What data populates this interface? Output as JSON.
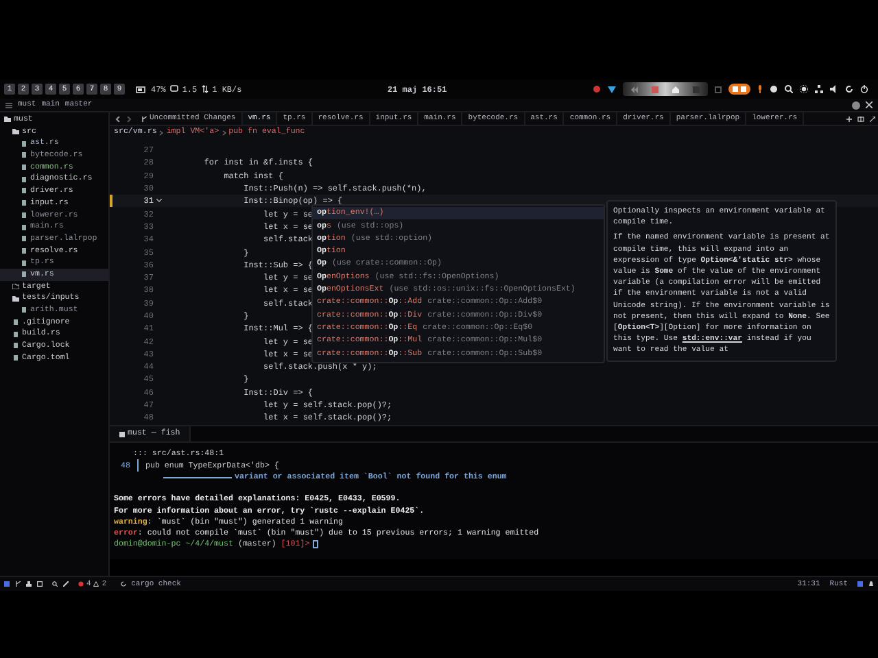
{
  "system_bar": {
    "workspaces": [
      "1",
      "2",
      "3",
      "4",
      "5",
      "6",
      "7",
      "8",
      "9"
    ],
    "battery": "47%",
    "load": "1.5",
    "network": "1 KB/s",
    "clock": "21 maj 16:51"
  },
  "title_bar": {
    "project": "must",
    "worktree": "main",
    "branch": "master"
  },
  "sidebar": {
    "items": [
      {
        "label": "must",
        "kind": "folder",
        "expanded": true,
        "selected": false,
        "children": [
          {
            "label": "src",
            "kind": "folder",
            "expanded": true,
            "selected": false,
            "children": [
              {
                "label": "ast.rs",
                "kind": "file",
                "selected": false,
                "color": "#a9b4c4"
              },
              {
                "label": "bytecode.rs",
                "kind": "file",
                "selected": false,
                "color": "#8a8f99"
              },
              {
                "label": "common.rs",
                "kind": "file",
                "selected": false,
                "color": "#8fb98b"
              },
              {
                "label": "diagnostic.rs",
                "kind": "file",
                "selected": false
              },
              {
                "label": "driver.rs",
                "kind": "file",
                "selected": false
              },
              {
                "label": "input.rs",
                "kind": "file",
                "selected": false
              },
              {
                "label": "lowerer.rs",
                "kind": "file",
                "selected": false,
                "color": "#8a8f99"
              },
              {
                "label": "main.rs",
                "kind": "file",
                "selected": false,
                "color": "#8a8f99"
              },
              {
                "label": "parser.lalrpop",
                "kind": "file",
                "selected": false,
                "color": "#8a8f99"
              },
              {
                "label": "resolve.rs",
                "kind": "file",
                "selected": false
              },
              {
                "label": "tp.rs",
                "kind": "file",
                "selected": false,
                "color": "#8a8f99"
              },
              {
                "label": "vm.rs",
                "kind": "file",
                "selected": true
              }
            ]
          },
          {
            "label": "target",
            "kind": "folder",
            "expanded": false,
            "selected": false
          },
          {
            "label": "tests/inputs",
            "kind": "folder",
            "expanded": true,
            "selected": false,
            "children": [
              {
                "label": "arith.must",
                "kind": "file",
                "selected": false,
                "color": "#8a8f99"
              }
            ]
          },
          {
            "label": ".gitignore",
            "kind": "file",
            "selected": false
          },
          {
            "label": "build.rs",
            "kind": "file",
            "selected": false
          },
          {
            "label": "Cargo.lock",
            "kind": "file",
            "selected": false
          },
          {
            "label": "Cargo.toml",
            "kind": "file",
            "selected": false
          }
        ]
      }
    ]
  },
  "tabs": [
    {
      "label": "Uncommitted Changes",
      "kind": "diff",
      "selected": false
    },
    {
      "label": "vm.rs",
      "kind": "file",
      "selected": true
    },
    {
      "label": "tp.rs",
      "kind": "file",
      "selected": false
    },
    {
      "label": "resolve.rs",
      "kind": "file",
      "selected": false
    },
    {
      "label": "input.rs",
      "kind": "file",
      "selected": false
    },
    {
      "label": "main.rs",
      "kind": "file",
      "selected": false
    },
    {
      "label": "bytecode.rs",
      "kind": "file",
      "selected": false
    },
    {
      "label": "ast.rs",
      "kind": "file",
      "selected": false
    },
    {
      "label": "common.rs",
      "kind": "file",
      "selected": false
    },
    {
      "label": "driver.rs",
      "kind": "file",
      "selected": false
    },
    {
      "label": "parser.lalrpop",
      "kind": "file",
      "selected": false
    },
    {
      "label": "lowerer.rs",
      "kind": "file",
      "selected": false
    }
  ],
  "breadcrumb": [
    "src/vm.rs",
    "impl VM<'a>",
    "pub fn eval_func"
  ],
  "editor": {
    "lines": [
      {
        "number": "27",
        "current": false
      },
      {
        "number": "28",
        "code": "        for inst in &f.insts {",
        "current": false
      },
      {
        "number": "29",
        "code": "            match inst {",
        "current": false
      },
      {
        "number": "30",
        "code": "                Inst::Push(n) => self.stack.push(*n),",
        "current": false
      },
      {
        "number": "31",
        "code": "                Inst::Binop(op) => {",
        "current": true
      },
      {
        "number": "32",
        "code": "                    let y = se",
        "current": false
      },
      {
        "number": "33",
        "code": "                    let x = se",
        "current": false
      },
      {
        "number": "34",
        "code": "                    self.stack",
        "current": false
      },
      {
        "number": "35",
        "code": "                }",
        "current": false
      },
      {
        "number": "36",
        "code": "                Inst::Sub => {",
        "current": false
      },
      {
        "number": "37",
        "code": "                    let y = se",
        "current": false
      },
      {
        "number": "38",
        "code": "                    let x = se",
        "current": false
      },
      {
        "number": "39",
        "code": "                    self.stack",
        "current": false
      },
      {
        "number": "40",
        "code": "                }",
        "current": false
      },
      {
        "number": "41",
        "code": "                Inst::Mul => {",
        "current": false
      },
      {
        "number": "42",
        "code": "                    let y = se",
        "current": false
      },
      {
        "number": "43",
        "code": "                    let x = se",
        "current": false
      },
      {
        "number": "44",
        "code": "                    self.stack.push(x * y);",
        "current": false
      },
      {
        "number": "45",
        "code": "                }",
        "current": false
      },
      {
        "number": "46",
        "code": "                Inst::Div => {",
        "current": false
      },
      {
        "number": "47",
        "code": "                    let y = self.stack.pop()?;",
        "current": false
      },
      {
        "number": "48",
        "code": "                    let x = self.stack.pop()?;",
        "current": false
      }
    ]
  },
  "completion": {
    "items": [
      {
        "label": "**op**tion_env!(…)",
        "selected": true
      },
      {
        "label": "**op**s",
        "detail": "(use std::ops)",
        "selected": false
      },
      {
        "label": "**op**tion",
        "detail": "(use std::option)",
        "selected": false
      },
      {
        "label": "**Op**tion",
        "selected": false
      },
      {
        "label": "**Op**",
        "detail": "(use crate::common::Op)",
        "selected": false
      },
      {
        "label": "**Op**enOptions",
        "detail": "(use std::fs::OpenOptions)",
        "selected": false
      },
      {
        "label": "**Op**enOptionsExt",
        "detail": "(use std::os::unix::fs::OpenOptionsExt)",
        "selected": false
      },
      {
        "label": "crate::common::**Op**::Add",
        "detail": "crate::common::Op::Add$0",
        "selected": false
      },
      {
        "label": "crate::common::**Op**::Div",
        "detail": "crate::common::Op::Div$0",
        "selected": false
      },
      {
        "label": "crate::common::**Op**::Eq",
        "detail": "crate::common::Op::Eq$0",
        "selected": false
      },
      {
        "label": "crate::common::**Op**::Mul",
        "detail": "crate::common::Op::Mul$0",
        "selected": false
      },
      {
        "label": "crate::common::**Op**::Sub",
        "detail": "crate::common::Op::Sub$0",
        "selected": false
      }
    ]
  },
  "documentation": {
    "summary": "Optionally inspects an environment variable at compile time.",
    "body": "If the named environment variable is present at compile time, this will expand into an expression of type **Option<&'static str>** whose value is **Some** of the value of the environment variable (a compilation error will be emitted if the environment variable is not a valid Unicode string). If the environment variable is not present, then this will expand to **None**. See [**Option<T>**][Option] for more information on this type.  Use",
    "link": "std::env::var",
    "after_link": "instead if you want to read the value at"
  },
  "terminal": {
    "tab": "must — fish",
    "lines": [
      {
        "kind": "location",
        "text": "::: src/ast.rs:48:1"
      },
      {
        "kind": "source",
        "number": "48",
        "text": "pub enum TypeExprData<'db> {"
      },
      {
        "kind": "annotation",
        "text": "variant or associated item `Bool` not found for this enum"
      },
      {
        "kind": "note",
        "text": "Some errors have detailed explanations: E0425, E0433, E0599."
      },
      {
        "kind": "note",
        "text": "For more information about an error, try `rustc --explain E0425`."
      },
      {
        "kind": "warning",
        "label": "warning",
        "text": ": `must` (bin \"must\") generated 1 warning"
      },
      {
        "kind": "error",
        "label": "error",
        "text": ": could not compile `must` (bin \"must\") due to 15 previous errors; 1 warning emitted"
      },
      {
        "kind": "prompt",
        "user": "domin@domin-pc",
        "path": "~/4/4/must",
        "branch": "(master)",
        "code": "[101]>"
      }
    ]
  },
  "status_bar": {
    "errors": "4",
    "warnings": "2",
    "task": "cargo check",
    "position": "31:31",
    "language": "Rust"
  }
}
